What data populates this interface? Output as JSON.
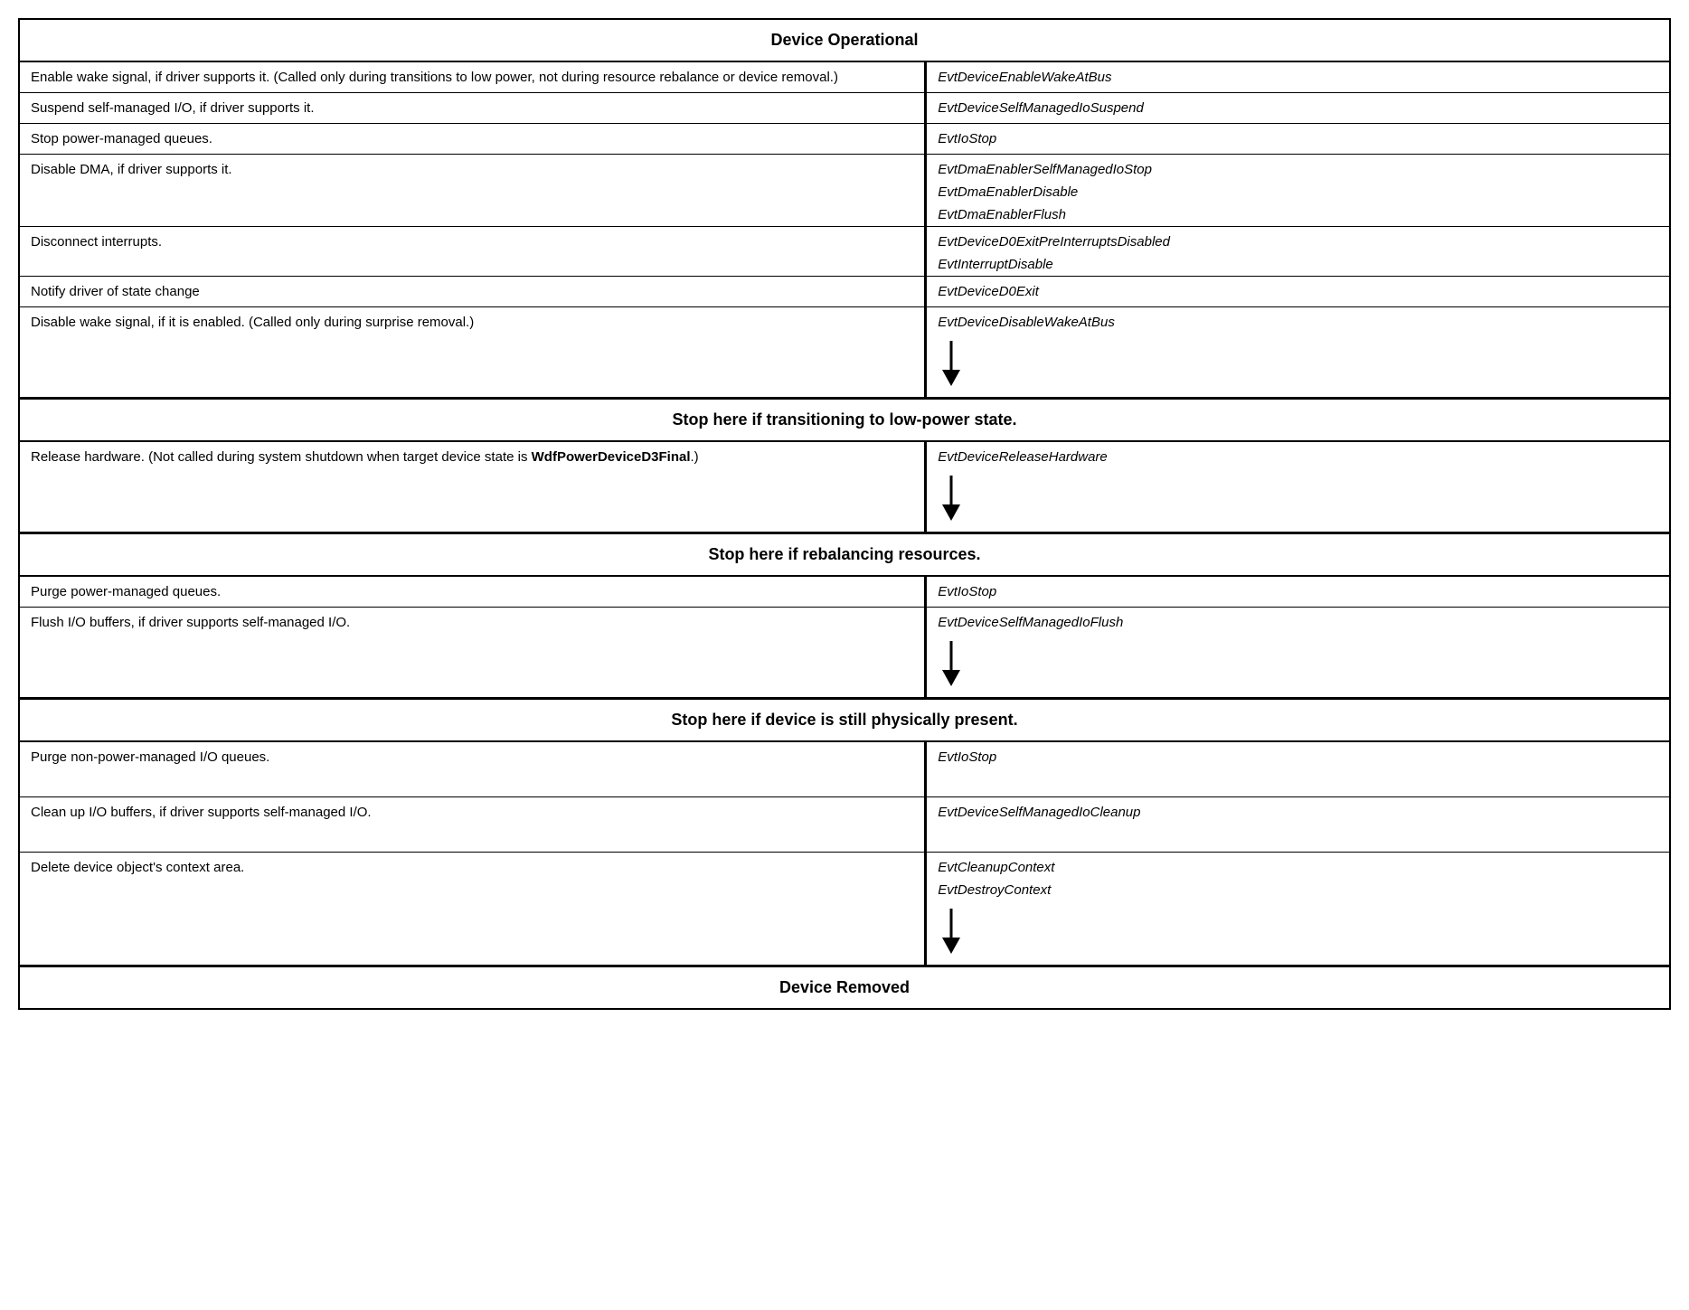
{
  "title": "Device Operational",
  "footer_title": "Device Removed",
  "sections": {
    "section1": {
      "rows": [
        {
          "left": "Enable wake signal, if driver supports it. (Called only during transitions to low power, not during resource rebalance or device removal.)",
          "right": [
            "EvtDeviceEnableWakeAtBus"
          ],
          "arrow": false
        },
        {
          "left": "Suspend self-managed I/O, if driver supports it.",
          "right": [
            "EvtDeviceSelfManagedIoSuspend"
          ],
          "arrow": false
        },
        {
          "left": "Stop power-managed queues.",
          "right": [
            "EvtIoStop"
          ],
          "arrow": false
        },
        {
          "left": "Disable DMA, if driver supports it.",
          "right": [
            "EvtDmaEnablerSelfManagedIoStop",
            "EvtDmaEnablerDisable",
            "EvtDmaEnablerFlush"
          ],
          "arrow": false
        },
        {
          "left": "Disconnect interrupts.",
          "right": [
            "EvtDeviceD0ExitPreInterruptsDisabled",
            "EvtInterruptDisable"
          ],
          "arrow": false
        },
        {
          "left": "Notify driver of state change",
          "right": [
            "EvtDeviceD0Exit"
          ],
          "arrow": false
        },
        {
          "left": "Disable wake signal, if it is enabled. (Called only during surprise removal.)",
          "right": [
            "EvtDeviceDisableWakeAtBus"
          ],
          "arrow": true
        }
      ],
      "divider": "Stop here if transitioning to low-power state."
    },
    "section2": {
      "rows": [
        {
          "left": "Release hardware. (Not called during system shutdown when target device state is WdfPowerDeviceD3Final.)",
          "left_bold": "WdfPowerDeviceD3Final",
          "right": [
            "EvtDeviceReleaseHardware"
          ],
          "arrow": true
        }
      ],
      "divider": "Stop here if rebalancing resources."
    },
    "section3": {
      "rows": [
        {
          "left": "Purge power-managed queues.",
          "right": [
            "EvtIoStop"
          ],
          "arrow": false
        },
        {
          "left": "Flush I/O buffers, if driver supports self-managed I/O.",
          "right": [
            "EvtDeviceSelfManagedIoFlush"
          ],
          "arrow": true
        }
      ],
      "divider": "Stop here if device is still physically present."
    },
    "section4": {
      "rows": [
        {
          "left": "Purge non-power-managed I/O queues.",
          "right": [
            "EvtIoStop"
          ],
          "arrow": false
        },
        {
          "left": "Clean up I/O buffers, if driver supports self-managed I/O.",
          "right": [
            "EvtDeviceSelfManagedIoCleanup"
          ],
          "arrow": false
        },
        {
          "left": "Delete device object's context area.",
          "right": [
            "EvtCleanupContext",
            "EvtDestroyContext"
          ],
          "arrow": true
        }
      ]
    }
  }
}
